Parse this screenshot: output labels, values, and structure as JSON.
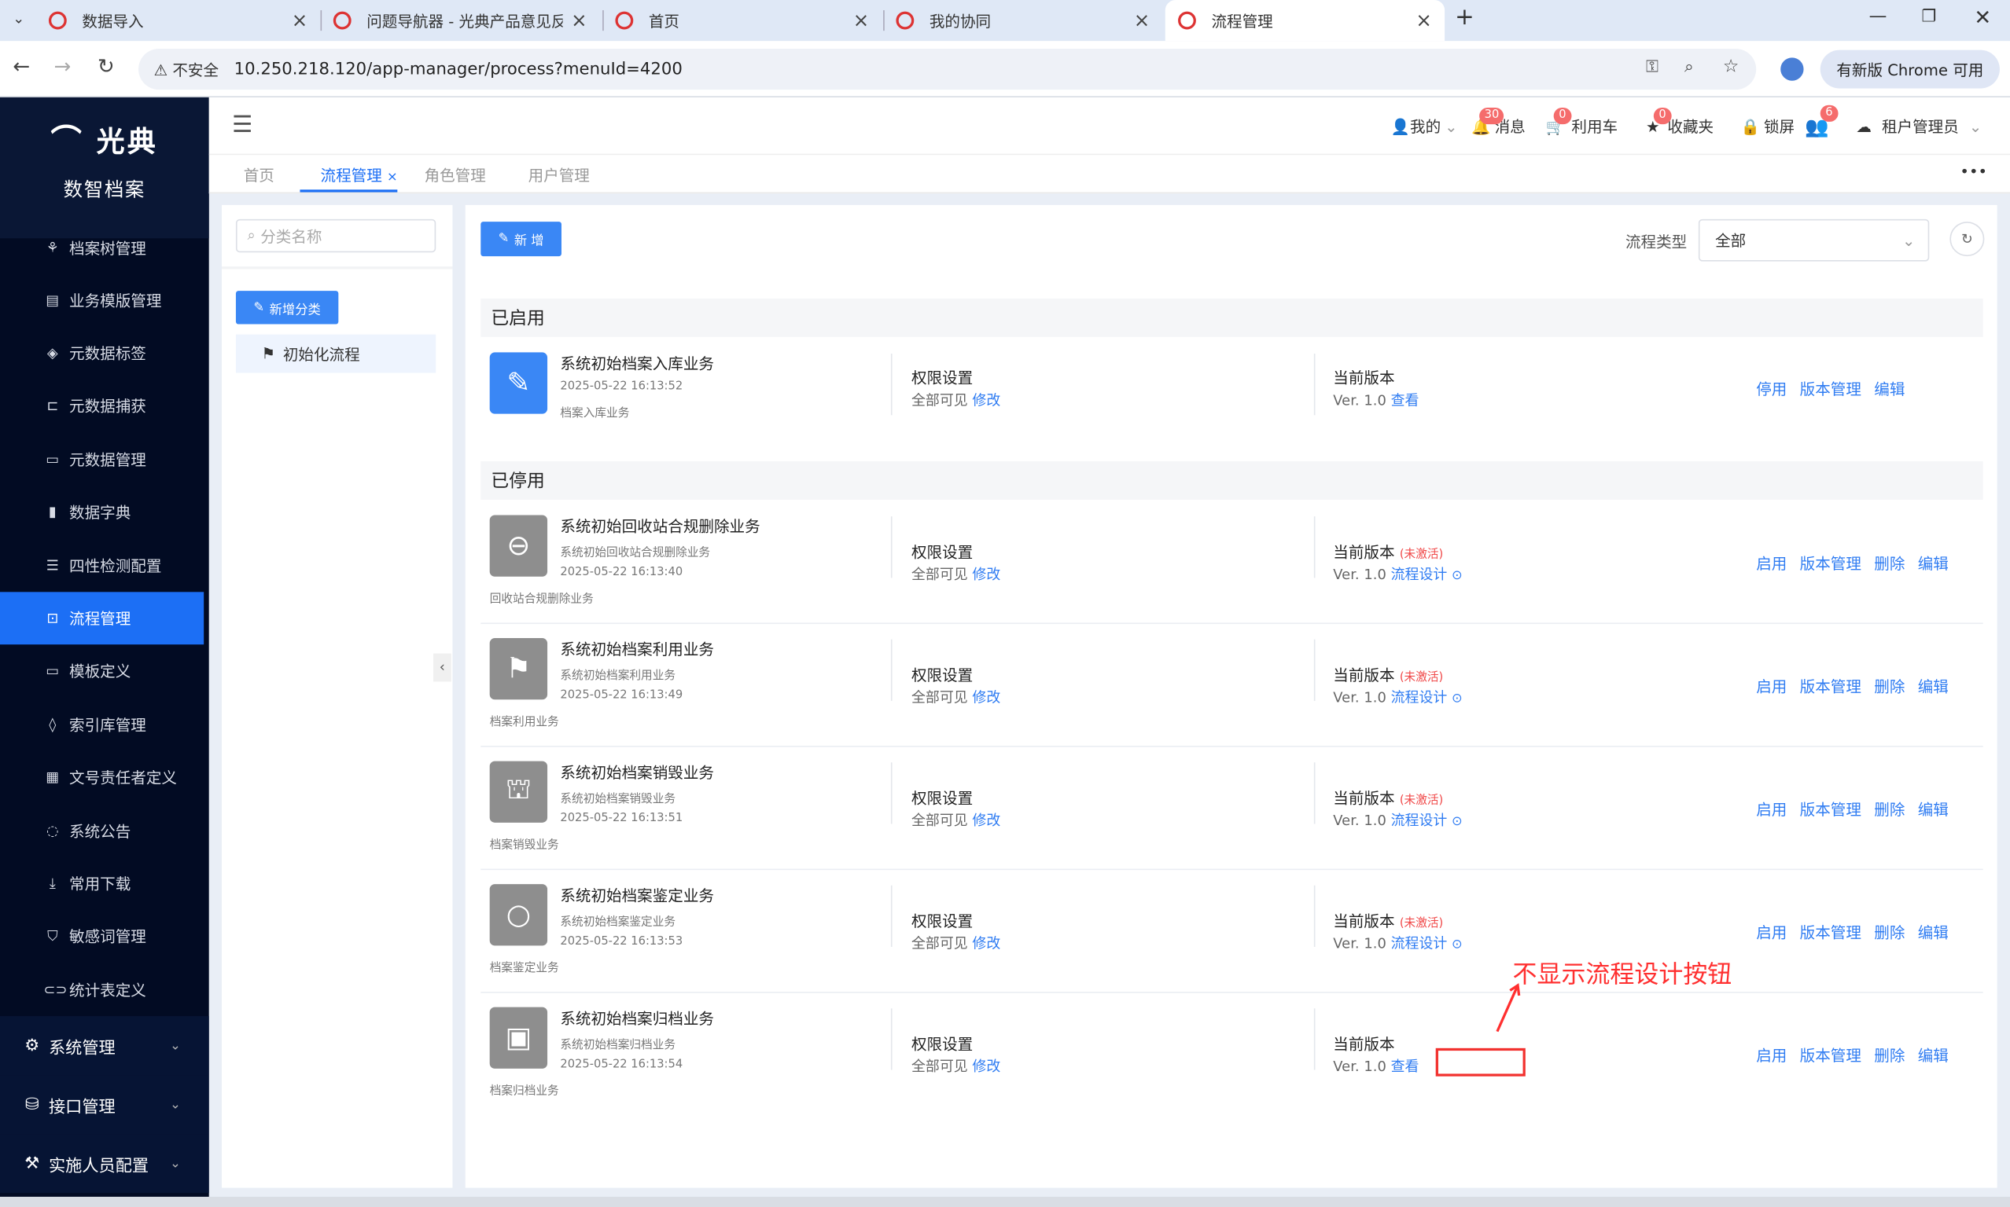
{
  "browser": {
    "tabs": [
      {
        "title": "数据导入"
      },
      {
        "title": "问题导航器 - 光典产品意见反馈"
      },
      {
        "title": "首页"
      },
      {
        "title": "我的协同"
      },
      {
        "title": "流程管理"
      }
    ],
    "new_tab": "+",
    "security_label": "不安全",
    "url": "10.250.218.120/app-manager/process?menuId=4200",
    "update_button": "有新版 Chrome 可用"
  },
  "sidebar": {
    "logo_text": "光典",
    "subtitle": "数智档案",
    "items": [
      {
        "label": "档案树管理",
        "icon": "tree-icon"
      },
      {
        "label": "业务模版管理",
        "icon": "template-icon"
      },
      {
        "label": "元数据标签",
        "icon": "tag-icon"
      },
      {
        "label": "元数据捕获",
        "icon": "crop-icon"
      },
      {
        "label": "元数据管理",
        "icon": "card-icon"
      },
      {
        "label": "数据字典",
        "icon": "book-icon"
      },
      {
        "label": "四性检测配置",
        "icon": "sliders-icon"
      },
      {
        "label": "流程管理",
        "icon": "process-icon"
      },
      {
        "label": "模板定义",
        "icon": "folder-icon"
      },
      {
        "label": "索引库管理",
        "icon": "layers-icon"
      },
      {
        "label": "文号责任者定义",
        "icon": "grid-icon"
      },
      {
        "label": "系统公告",
        "icon": "chat-icon"
      },
      {
        "label": "常用下载",
        "icon": "download-icon"
      },
      {
        "label": "敏感词管理",
        "icon": "shield-icon"
      },
      {
        "label": "统计表定义",
        "icon": "toggle-icon"
      }
    ],
    "groups": [
      {
        "label": "系统管理"
      },
      {
        "label": "接口管理"
      },
      {
        "label": "实施人员配置"
      }
    ]
  },
  "topbar": {
    "my": "我的",
    "messages": "消息",
    "messages_count": "30",
    "cart": "利用车",
    "cart_count": "0",
    "favorites": "收藏夹",
    "favorites_count": "0",
    "lock": "锁屏",
    "users_count": "6",
    "tenant": "租户管理员"
  },
  "tags": [
    {
      "label": "首页"
    },
    {
      "label": "流程管理"
    },
    {
      "label": "角色管理"
    },
    {
      "label": "用户管理"
    }
  ],
  "tag_close": "×",
  "more": "•••",
  "left": {
    "search_placeholder": "分类名称",
    "add_category": "新增分类",
    "category": "初始化流程"
  },
  "toolbar": {
    "add": "新 增",
    "type_label": "流程类型",
    "type_value": "全部"
  },
  "sections": {
    "enabled": "已启用",
    "disabled": "已停用"
  },
  "labels": {
    "perm": "权限设置",
    "visible": "全部可见",
    "modify": "修改",
    "version_label": "当前版本",
    "version": "Ver. 1.0",
    "view": "查看",
    "design": "流程设计",
    "inactive": "(未激活)"
  },
  "ops": {
    "enable": "启用",
    "disable": "停用",
    "version_mgr": "版本管理",
    "delete": "删除",
    "edit": "编辑"
  },
  "enabled_rows": [
    {
      "title": "系统初始档案入库业务",
      "date": "2025-05-22 16:13:52",
      "desc": "档案入库业务"
    }
  ],
  "disabled_rows": [
    {
      "title": "系统初始回收站合规删除业务",
      "subtitle": "系统初始回收站合规删除业务",
      "date": "2025-05-22 16:13:40",
      "desc": "回收站合规删除业务"
    },
    {
      "title": "系统初始档案利用业务",
      "subtitle": "系统初始档案利用业务",
      "date": "2025-05-22 16:13:49",
      "desc": "档案利用业务"
    },
    {
      "title": "系统初始档案销毁业务",
      "subtitle": "系统初始档案销毁业务",
      "date": "2025-05-22 16:13:51",
      "desc": "档案销毁业务"
    },
    {
      "title": "系统初始档案鉴定业务",
      "subtitle": "系统初始档案鉴定业务",
      "date": "2025-05-22 16:13:53",
      "desc": "档案鉴定业务"
    },
    {
      "title": "系统初始档案归档业务",
      "subtitle": "系统初始档案归档业务",
      "date": "2025-05-22 16:13:54",
      "desc": "档案归档业务"
    }
  ],
  "annotation": "不显示流程设计按钮",
  "colors": {
    "accent": "#1c6ff5",
    "sidebar": "#020b23",
    "annotation": "#ff2f2f"
  }
}
